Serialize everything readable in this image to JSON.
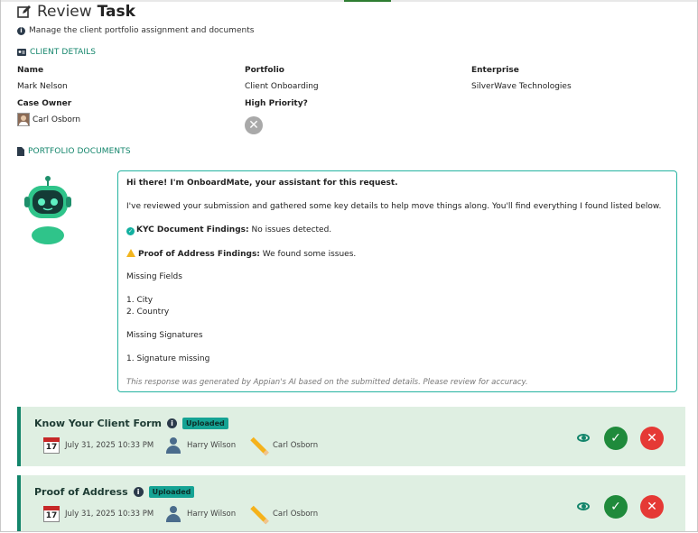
{
  "header": {
    "title_light": "Review",
    "title_bold": "Task",
    "subtitle": "Manage the client portfolio assignment and documents"
  },
  "client_details": {
    "section_label": "CLIENT DETAILS",
    "name_label": "Name",
    "name_value": "Mark Nelson",
    "portfolio_label": "Portfolio",
    "portfolio_value": "Client Onboarding",
    "enterprise_label": "Enterprise",
    "enterprise_value": "SilverWave Technologies",
    "case_owner_label": "Case Owner",
    "case_owner_value": "Carl Osborn",
    "high_priority_label": "High Priority?"
  },
  "portfolio_documents": {
    "section_label": "PORTFOLIO DOCUMENTS"
  },
  "assistant": {
    "greeting": "Hi there! I'm OnboardMate, your assistant for this request.",
    "intro": "I've reviewed your submission and gathered some key details to help move things along. You'll find everything I found listed below.",
    "kyc_label": "KYC Document Findings:",
    "kyc_text": "No issues detected.",
    "poa_label": "Proof of Address Findings:",
    "poa_text": "We found some issues.",
    "missing_fields_heading": "Missing Fields",
    "missing_field_1": "1. City",
    "missing_field_2": "2. Country",
    "missing_signatures_heading": "Missing Signatures",
    "missing_signature_1": "1. Signature missing",
    "disclaimer": "This response was generated by Appian's AI based on the submitted details. Please review for accuracy."
  },
  "documents": [
    {
      "title": "Know Your Client Form",
      "status": "Uploaded",
      "date": "July 31, 2025 10:33 PM",
      "calendar_day": "17",
      "uploaded_by": "Harry Wilson",
      "reviewer": "Carl Osborn"
    },
    {
      "title": "Proof of Address",
      "status": "Uploaded",
      "date": "July 31, 2025 10:33 PM",
      "calendar_day": "17",
      "uploaded_by": "Harry Wilson",
      "reviewer": "Carl Osborn"
    }
  ],
  "colors": {
    "accent": "#13856b",
    "card_bg": "#dfefe2",
    "badge": "#15a394",
    "approve": "#1f8a3b",
    "reject": "#e53935"
  }
}
